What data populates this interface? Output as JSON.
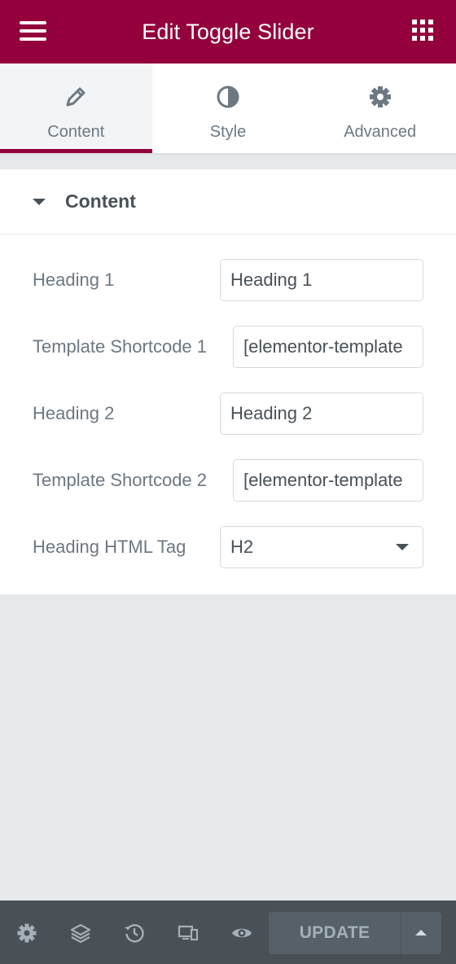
{
  "header": {
    "title": "Edit Toggle Slider",
    "menu_icon": "hamburger-icon",
    "apps_icon": "grid-icon",
    "bg_color": "#93003c"
  },
  "tabs": [
    {
      "label": "Content",
      "icon": "pencil-icon",
      "active": true
    },
    {
      "label": "Style",
      "icon": "contrast-icon",
      "active": false
    },
    {
      "label": "Advanced",
      "icon": "gear-icon",
      "active": false
    }
  ],
  "section": {
    "title": "Content",
    "fields": [
      {
        "label": "Heading 1",
        "value": "Heading 1"
      },
      {
        "label": "Template Shortcode 1",
        "value": "[elementor-template"
      },
      {
        "label": "Heading 2",
        "value": "Heading 2"
      },
      {
        "label": "Template Shortcode 2",
        "value": "[elementor-template"
      },
      {
        "label": "Heading HTML Tag",
        "value": "H2"
      }
    ]
  },
  "footer": {
    "icons": [
      "settings-icon",
      "layers-icon",
      "history-icon",
      "responsive-icon",
      "preview-icon"
    ],
    "update_label": "UPDATE"
  }
}
